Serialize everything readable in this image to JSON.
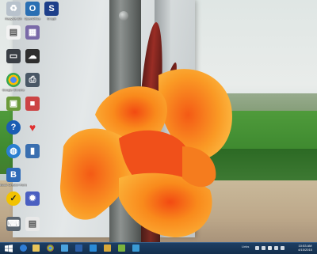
{
  "desktop": {
    "icons": [
      {
        "label": "Recycle Bin",
        "icon": "recycle-bin-icon",
        "color": "#b8c2cc"
      },
      {
        "label": "OpenOffice",
        "icon": "openoffice-icon",
        "color": "#2a6fb3"
      },
      {
        "label": "SnagIt",
        "icon": "snagit-icon",
        "color": "#1e3f8a"
      },
      {
        "label": "",
        "icon": "document-icon",
        "color": "#f2f2f2"
      },
      {
        "label": "",
        "icon": "wallpaper-icon",
        "color": "#7a6aa8"
      },
      {
        "label": "",
        "icon": "monitor-icon",
        "color": "#3a3f45"
      },
      {
        "label": "",
        "icon": "cloud-icon",
        "color": "#2e2e2e"
      },
      {
        "label": "Google Chrome",
        "icon": "chrome-icon",
        "color": "#dd4b39"
      },
      {
        "label": "",
        "icon": "printer-icon",
        "color": "#4a5866"
      },
      {
        "label": "",
        "icon": "photo-app-icon",
        "color": "#6a9a3a"
      },
      {
        "label": "",
        "icon": "game-icon",
        "color": "#c44"
      },
      {
        "label": "",
        "icon": "help-icon",
        "color": "#1b5db3"
      },
      {
        "label": "",
        "icon": "heart-icon",
        "color": "#e03030"
      },
      {
        "label": "",
        "icon": "globe-icon",
        "color": "#2a7fd0"
      },
      {
        "label": "",
        "icon": "usb-icon",
        "color": "#3a6fb0"
      },
      {
        "label": "Book Creator Home",
        "icon": "book-creator-icon",
        "color": "#2f6bb8"
      },
      {
        "label": "",
        "icon": "norton-icon",
        "color": "#f2c200"
      },
      {
        "label": "",
        "icon": "gear-app-icon",
        "color": "#4a5fc1"
      },
      {
        "label": "",
        "icon": "keyboard-icon",
        "color": "#5a6570"
      },
      {
        "label": "",
        "icon": "file-icon",
        "color": "#e8e8e8"
      }
    ]
  },
  "taskbar": {
    "pinned": [
      {
        "name": "windows-start-icon",
        "color": "#ffffff"
      },
      {
        "name": "ie-icon",
        "color": "#2f7dd6"
      },
      {
        "name": "file-explorer-icon",
        "color": "#e8c45a"
      },
      {
        "name": "chrome-taskbar-icon",
        "color": "#dd4b39"
      },
      {
        "name": "photos-taskbar-icon",
        "color": "#4aa3df"
      },
      {
        "name": "ps-taskbar-icon",
        "color": "#2b5fa8"
      },
      {
        "name": "mail-taskbar-icon",
        "color": "#2a8bd8"
      },
      {
        "name": "folder-taskbar-icon",
        "color": "#d9a93a"
      },
      {
        "name": "app-taskbar-icon",
        "color": "#7ab33d"
      },
      {
        "name": "screen-taskbar-icon",
        "color": "#3a9bd6"
      }
    ],
    "tray_label": "Links",
    "tray_icons": [
      "volume-icon",
      "network-icon",
      "flag-icon",
      "battery-icon",
      "keyboard-tray-icon"
    ],
    "clock_time": "10:53 AM",
    "clock_date": "4/15/2015"
  }
}
